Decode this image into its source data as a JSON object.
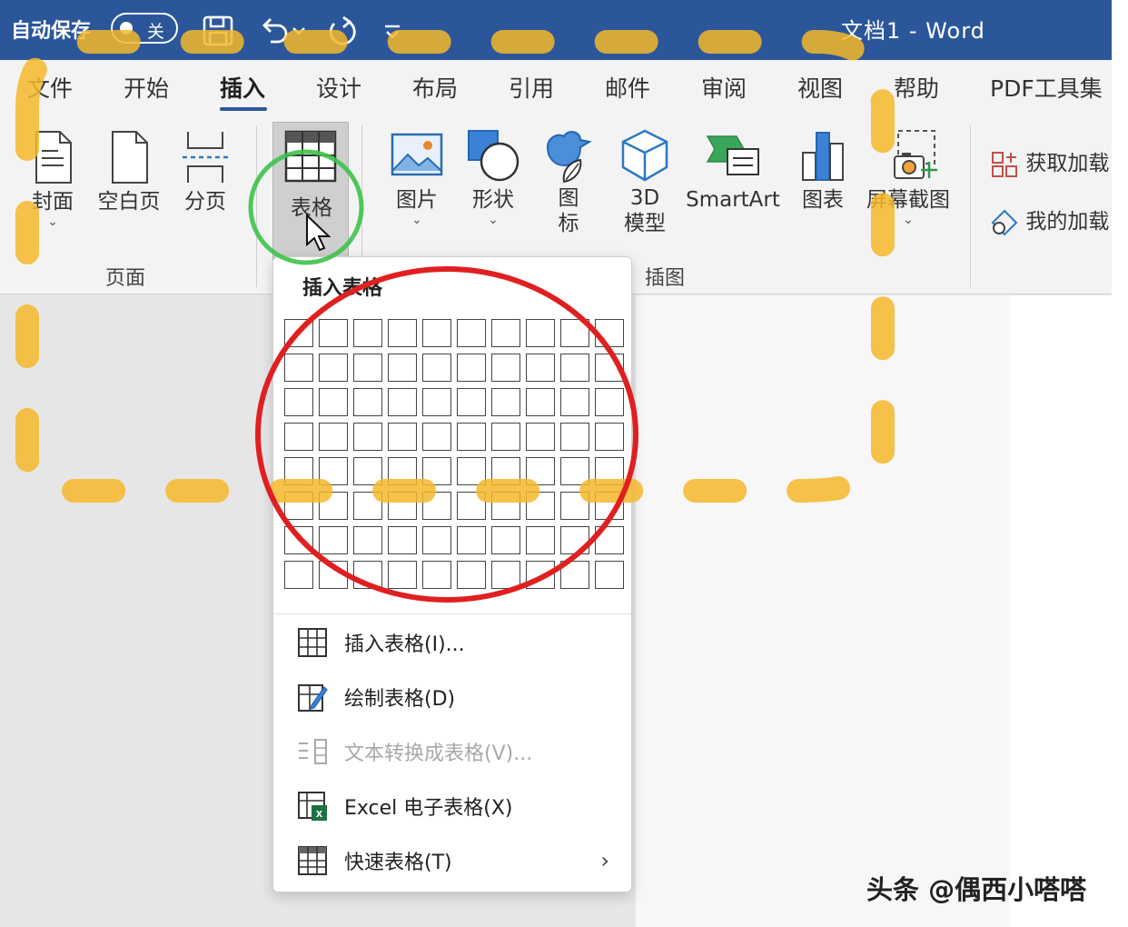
{
  "titlebar": {
    "autosave_label": "自动保存",
    "autosave_state": "关",
    "doc_title": "文档1  -  Word"
  },
  "tabs": [
    {
      "label": "文件",
      "active": false
    },
    {
      "label": "开始",
      "active": false
    },
    {
      "label": "插入",
      "active": true
    },
    {
      "label": "设计",
      "active": false
    },
    {
      "label": "布局",
      "active": false
    },
    {
      "label": "引用",
      "active": false
    },
    {
      "label": "邮件",
      "active": false
    },
    {
      "label": "审阅",
      "active": false
    },
    {
      "label": "视图",
      "active": false
    },
    {
      "label": "帮助",
      "active": false
    },
    {
      "label": "PDF工具集",
      "active": false
    }
  ],
  "ribbon": {
    "pages": {
      "cover": "封面",
      "blank": "空白页",
      "break": "分页",
      "group_label": "页面"
    },
    "table": {
      "label": "表格"
    },
    "illustrations": {
      "picture": "图片",
      "shapes": "形状",
      "icons_line1": "图",
      "icons_line2": "标",
      "model_line1": "3D",
      "model_line2": "模型",
      "smartart": "SmartArt",
      "chart": "图表",
      "screenshot": "屏幕截图",
      "group_label": "插图"
    },
    "addins": {
      "get": "获取加载",
      "mine": "我的加载"
    }
  },
  "dropdown": {
    "header": "插入表格",
    "grid_cols": 10,
    "grid_rows": 8,
    "items": [
      {
        "label": "插入表格(I)...",
        "enabled": true,
        "icon": "table-icon"
      },
      {
        "label": "绘制表格(D)",
        "enabled": true,
        "icon": "draw-table-icon"
      },
      {
        "label": "文本转换成表格(V)...",
        "enabled": false,
        "icon": "convert-text-icon"
      },
      {
        "label": "Excel 电子表格(X)",
        "enabled": true,
        "icon": "excel-table-icon"
      },
      {
        "label": "快速表格(T)",
        "enabled": true,
        "icon": "quick-table-icon",
        "submenu": true
      }
    ],
    "submenu_arrow": "›"
  },
  "watermark": "头条 @偶西小嗒嗒",
  "colors": {
    "titlebar": "#2b579a",
    "annotation_circle_red": "#e02020",
    "annotation_circle_green": "#3ec24a",
    "annotation_dashes": "#f5b72a"
  }
}
